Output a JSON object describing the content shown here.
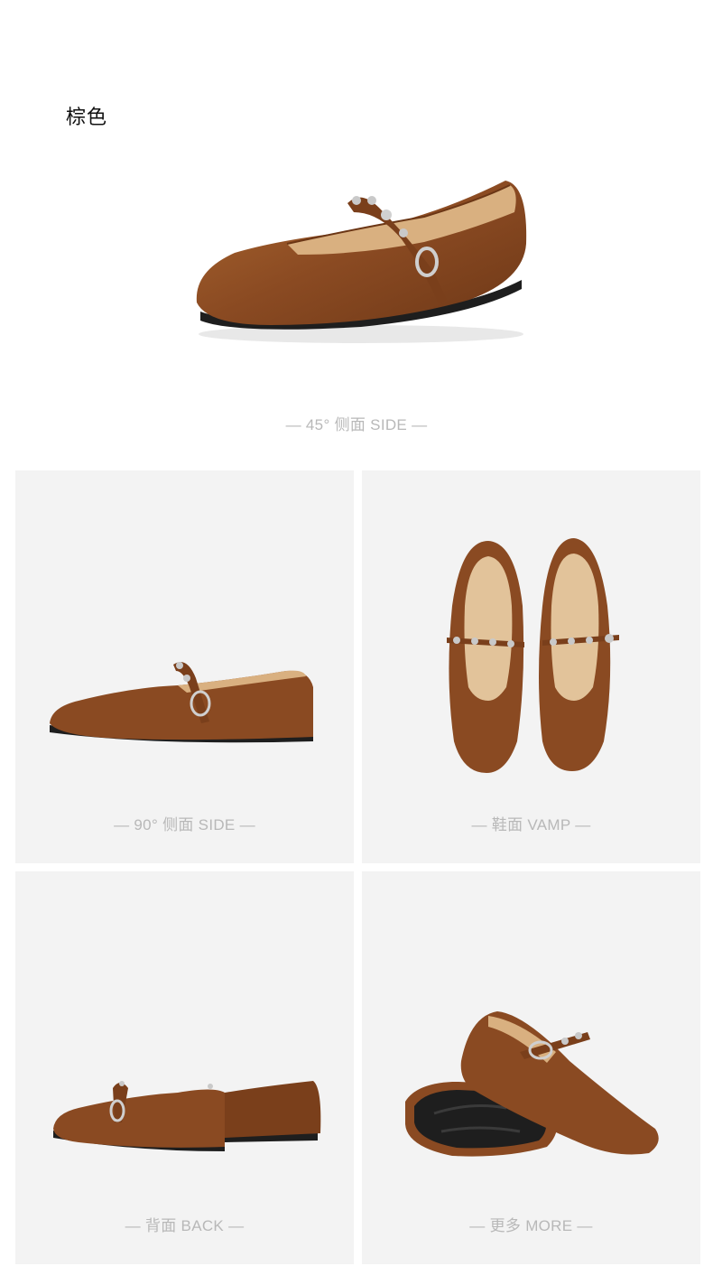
{
  "color_name": "棕色",
  "views": {
    "hero_caption": "— 45°  侧面 SIDE —",
    "side_caption": "— 90°  侧面 SIDE —",
    "vamp_caption": "— 鞋面 VAMP —",
    "back_caption": "— 背面 BACK —",
    "more_caption": "— 更多 MORE —"
  },
  "colors": {
    "leather": "#8a4a22",
    "leather_light": "#a9652f",
    "lining": "#e2c39a",
    "sole": "#1e1e1e",
    "tile_bg": "#f3f3f3",
    "caption": "#b8b8b8"
  }
}
